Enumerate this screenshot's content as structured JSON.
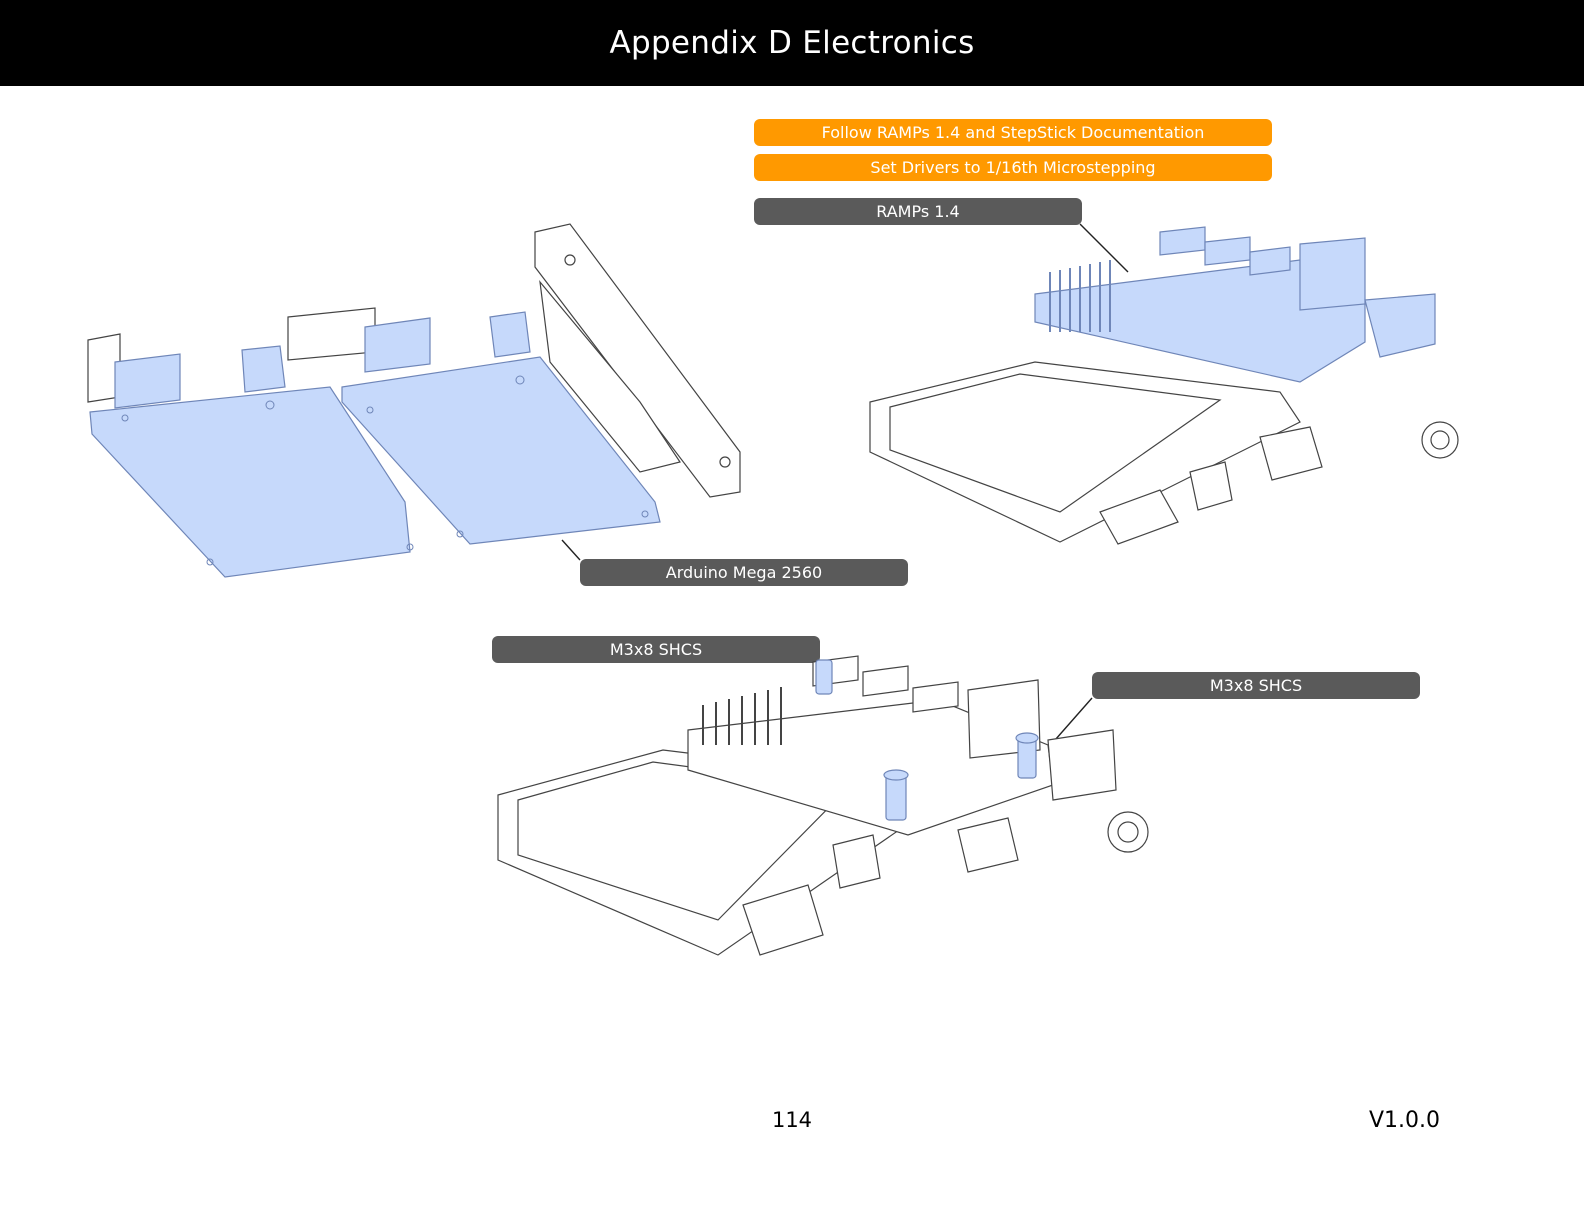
{
  "header": {
    "title": "Appendix D Electronics"
  },
  "notes": [
    "Follow RAMPs 1.4 and StepStick Documentation",
    "Set Drivers to 1/16th Microstepping"
  ],
  "callouts": {
    "ramps": "RAMPs 1.4",
    "arduino": "Arduino Mega 2560",
    "screw_left": "M3x8 SHCS",
    "screw_right": "M3x8 SHCS"
  },
  "footer": {
    "page_number": "114",
    "version": "V1.0.0"
  },
  "colors": {
    "header_bg": "#000000",
    "highlight": "#c6d9fb",
    "highlight_stroke": "#6f86b8",
    "note_bg": "#ff9900",
    "callout_bg": "#5a5a5a",
    "line_art": "#333333"
  }
}
